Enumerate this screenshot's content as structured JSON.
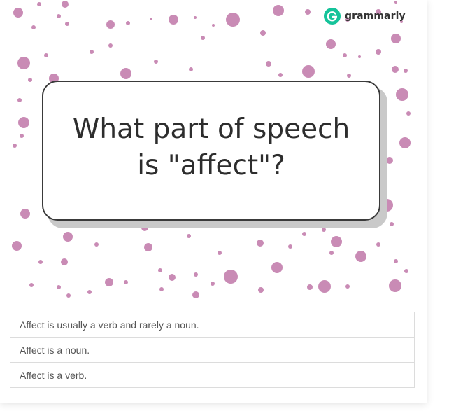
{
  "brand": {
    "name": "grammarly",
    "icon": "grammarly-g-icon",
    "color": "#15c39a"
  },
  "question": {
    "text": "What part of speech is \"affect\"?"
  },
  "answers": [
    {
      "label": "Affect is usually a verb and rarely a noun."
    },
    {
      "label": "Affect is a noun."
    },
    {
      "label": "Affect is a verb."
    }
  ],
  "colors": {
    "dots": "#c98bb5",
    "text": "#2d2d2d"
  }
}
